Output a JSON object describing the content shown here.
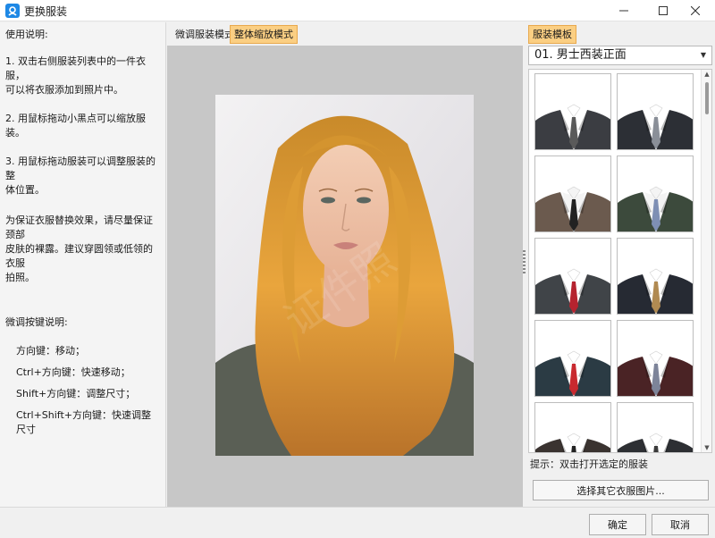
{
  "window": {
    "title": "更换服装",
    "icon": "app-logo-icon",
    "minimize_icon": "minimize-icon",
    "maximize_icon": "maximize-icon",
    "close_icon": "close-icon"
  },
  "instructions": {
    "title": "使用说明:",
    "item1": "1. 双击右侧服装列表中的一件衣服，\n可以将衣服添加到照片中。",
    "item2": "2. 用鼠标拖动小黑点可以缩放服装。",
    "item3": "3. 用鼠标拖动服装可以调整服装的整\n体位置。",
    "note": "为保证衣服替换效果，请尽量保证颈部\n皮肤的裸露。建议穿圆领或低领的衣服\n拍照。",
    "keys_title": "微调按键说明:",
    "keys": [
      "方向键：移动；",
      "Ctrl+方向键：快速移动；",
      "Shift+方向键：调整尺寸；",
      "Ctrl+Shift+方向键：快速调整尺寸"
    ]
  },
  "center": {
    "tabs": [
      {
        "label": "微调服装模式",
        "active": false
      },
      {
        "label": "整体缩放模式",
        "active": true
      }
    ]
  },
  "right": {
    "tab_label": "服装模板",
    "select_value": "01. 男士西装正面",
    "hint": "提示：双击打开选定的服装",
    "other_button": "选择其它衣服图片..."
  },
  "suits": [
    {
      "jacket": "#3b3d42",
      "shirt": "#ffffff",
      "tie": "#5a5a5a"
    },
    {
      "jacket": "#2c2f35",
      "shirt": "#ffffff",
      "tie": "#8a8f98"
    },
    {
      "jacket": "#6b5a4e",
      "shirt": "#f4f4f4",
      "tie": "#222222"
    },
    {
      "jacket": "#3c4a3c",
      "shirt": "#f4f4f4",
      "tie": "#7e8fb4"
    },
    {
      "jacket": "#404448",
      "shirt": "#ffffff",
      "tie": "#b5232f"
    },
    {
      "jacket": "#262a33",
      "shirt": "#ffffff",
      "tie": "#b08a52"
    },
    {
      "jacket": "#2b3b44",
      "shirt": "#ffffff",
      "tie": "#c8292f"
    },
    {
      "jacket": "#4a2325",
      "shirt": "#ffffff",
      "tie": "#7d8499"
    },
    {
      "jacket": "#3a3330",
      "shirt": "#ffffff",
      "tie": "#222222"
    },
    {
      "jacket": "#2d2f33",
      "shirt": "#ffffff",
      "tie": "#3a3a3a"
    }
  ],
  "buttons": {
    "ok": "确定",
    "cancel": "取消"
  },
  "colors": {
    "accent_tab": "#fbcf83",
    "canvas_bg": "#c7c7c7"
  }
}
